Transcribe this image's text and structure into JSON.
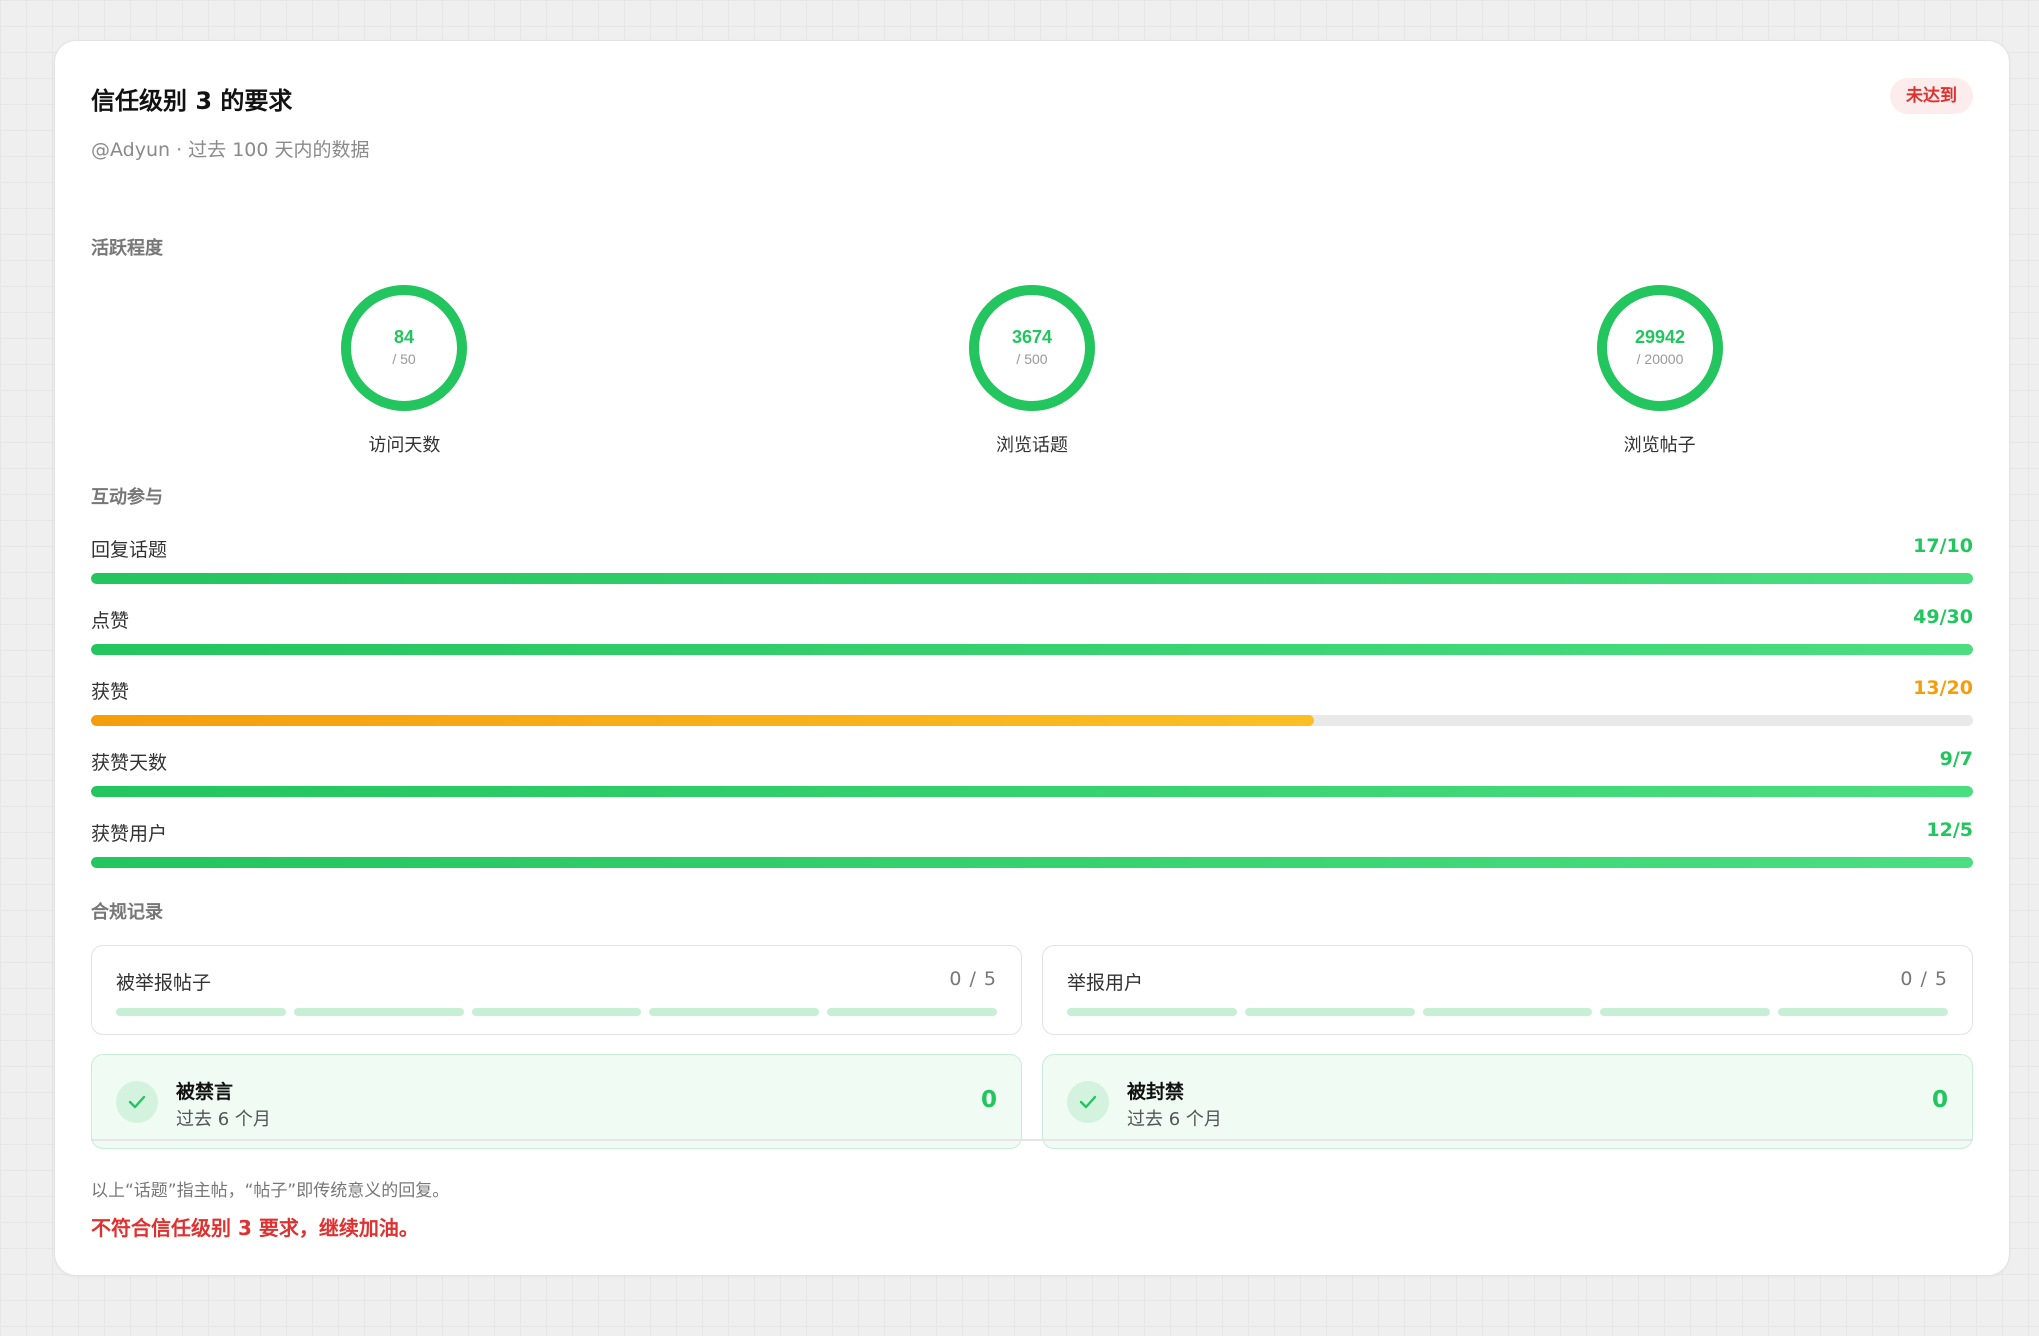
{
  "header": {
    "title": "信任级别 3 的要求",
    "badge": "未达到",
    "subtitle": "@Adyun · 过去 100 天内的数据"
  },
  "activity": {
    "label": "活跃程度",
    "rings": [
      {
        "value": "84",
        "target": "/ 50",
        "label": "访问天数",
        "progress": 1.0
      },
      {
        "value": "3674",
        "target": "/ 500",
        "label": "浏览话题",
        "progress": 1.0
      },
      {
        "value": "29942",
        "target": "/ 20000",
        "label": "浏览帖子",
        "progress": 1.0
      }
    ]
  },
  "engagement": {
    "label": "互动参与",
    "items": [
      {
        "label": "回复话题",
        "value": "17/10",
        "progress": 1.0,
        "status": "met"
      },
      {
        "label": "点赞",
        "value": "49/30",
        "progress": 1.0,
        "status": "met"
      },
      {
        "label": "获赞",
        "value": "13/20",
        "progress": 0.65,
        "status": "unmet"
      },
      {
        "label": "获赞天数",
        "value": "9/7",
        "progress": 1.0,
        "status": "met"
      },
      {
        "label": "获赞用户",
        "value": "12/5",
        "progress": 1.0,
        "status": "met"
      }
    ]
  },
  "compliance": {
    "label": "合规记录",
    "boxes": [
      {
        "label": "被举报帖子",
        "value": "0 / 5",
        "count": 0,
        "max": 5
      },
      {
        "label": "举报用户",
        "value": "0 / 5",
        "count": 0,
        "max": 5
      }
    ],
    "status": [
      {
        "title": "被禁言",
        "sub": "过去 6 个月",
        "count": "0"
      },
      {
        "title": "被封禁",
        "sub": "过去 6 个月",
        "count": "0"
      }
    ]
  },
  "footer": {
    "note": "以上“话题”指主帖，“帖子”即传统意义的回复。",
    "result": "不符合信任级别 3 要求，继续加油。"
  },
  "colors": {
    "green": "#22c55e",
    "orange": "#f59e0b",
    "red": "#e03131"
  }
}
